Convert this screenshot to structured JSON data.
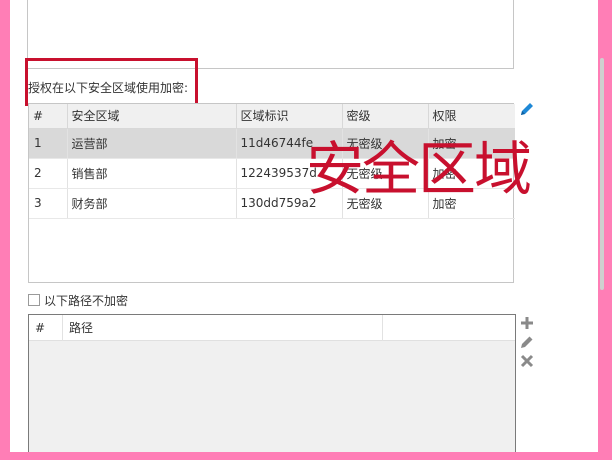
{
  "auth_section": {
    "label": "授权在以下安全区域使用加密:"
  },
  "zones_table": {
    "columns": [
      "#",
      "安全区域",
      "区域标识",
      "密级",
      "权限"
    ],
    "rows": [
      {
        "num": "1",
        "zone": "运营部",
        "id": "11d46744fe",
        "level": "无密级",
        "perm": "加密"
      },
      {
        "num": "2",
        "zone": "销售部",
        "id": "122439537d",
        "level": "无密级",
        "perm": "加密"
      },
      {
        "num": "3",
        "zone": "财务部",
        "id": "130dd759a2",
        "level": "无密级",
        "perm": "加密"
      }
    ],
    "selected_index": 0
  },
  "watermark": {
    "text": "安全区域"
  },
  "exclude": {
    "label": "以下路径不加密",
    "checked": false
  },
  "paths_table": {
    "columns": [
      "#",
      "路径",
      ""
    ]
  },
  "icons": {
    "edit_top": "pencil-icon",
    "add": "plus-icon",
    "edit": "pencil-icon",
    "remove": "close-icon"
  },
  "colors": {
    "accent_blue": "#1e88d6",
    "highlight_red": "#c8102e",
    "frame_pink": "#ff7eb6",
    "icon_gray": "#8a8a8a"
  }
}
